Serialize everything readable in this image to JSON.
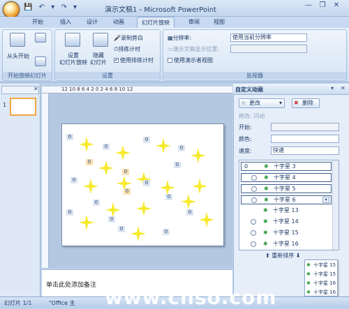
{
  "titlebar": {
    "title": "演示文稿1 - Microsoft PowerPoint",
    "quick_access": [
      "💾",
      "↶",
      "▾",
      "↷",
      "▾"
    ],
    "win_buttons": [
      "—",
      "❐",
      "✕"
    ]
  },
  "tabs": [
    {
      "label": "开始"
    },
    {
      "label": "插入"
    },
    {
      "label": "设计"
    },
    {
      "label": "动画"
    },
    {
      "label": "幻灯片放映",
      "active": true
    },
    {
      "label": "审阅"
    },
    {
      "label": "视图"
    }
  ],
  "ribbon": {
    "group1": {
      "label": "开始放映幻灯片",
      "from_start": "从头开始"
    },
    "group2": {
      "label": "设置",
      "setup": "设置\n幻灯片放映",
      "hide": "隐藏\n幻灯片",
      "record": "录制旁白",
      "rehearse": "排练计时",
      "use_rehearsed": "使用排练计时"
    },
    "group3": {
      "label": "监视器",
      "resolution_label": "分辨率:",
      "resolution_value": "使用当前分辨率",
      "show_on_label": "演示文稿显示位置:",
      "presenter_view": "使用演示者视图"
    }
  },
  "left_pane": {
    "slide_number": "1"
  },
  "ruler": {
    "ticks": "12 10  8  6  4  2  0  2  4  6  8 10 12"
  },
  "slide": {
    "tags": [
      {
        "t": "0"
      },
      {
        "t": "0"
      },
      {
        "t": "0"
      },
      {
        "t": "0"
      },
      {
        "t": "0"
      },
      {
        "t": "0",
        "o": true
      },
      {
        "t": "0",
        "o": true
      },
      {
        "t": "0"
      },
      {
        "t": "0",
        "o": true
      },
      {
        "t": "0"
      },
      {
        "t": "0"
      },
      {
        "t": "0"
      },
      {
        "t": "0"
      },
      {
        "t": "0"
      },
      {
        "t": "0"
      },
      {
        "t": "0"
      },
      {
        "t": "0"
      }
    ]
  },
  "notes": {
    "placeholder": "单击此处添加备注"
  },
  "status": {
    "slide": "幻灯片 1/1",
    "theme": "\"Office 主"
  },
  "right_pane": {
    "title": "自定义动画",
    "change_btn": "更改",
    "delete_btn": "删除",
    "modify_label": "修改: 闪动",
    "start_label": "开始:",
    "color_label": "颜色:",
    "speed_label": "速度:",
    "speed_value": "快速",
    "list": [
      {
        "num": "0",
        "name": "十字星 3",
        "boxed": true,
        "clock": false
      },
      {
        "num": "",
        "name": "十字星 4",
        "boxed": true,
        "clock": true
      },
      {
        "num": "",
        "name": "十字星 5",
        "boxed": true,
        "clock": true
      },
      {
        "num": "",
        "name": "十字星 6",
        "boxed": true,
        "clock": true,
        "dd": true
      },
      {
        "num": "",
        "name": "十字星 13",
        "boxed": false,
        "clock": false
      },
      {
        "num": "",
        "name": "十字星 14",
        "boxed": false,
        "clock": true
      },
      {
        "num": "",
        "name": "十字星 15",
        "boxed": false,
        "clock": true
      },
      {
        "num": "",
        "name": "十字星 16",
        "boxed": false,
        "clock": true
      }
    ],
    "reorder": "重新排序",
    "dropdown": [
      {
        "name": "十字星 15"
      },
      {
        "name": "十字星 15"
      },
      {
        "name": "十字星 16"
      },
      {
        "name": "十字星 16"
      }
    ]
  },
  "watermark": "www.cnso.com"
}
